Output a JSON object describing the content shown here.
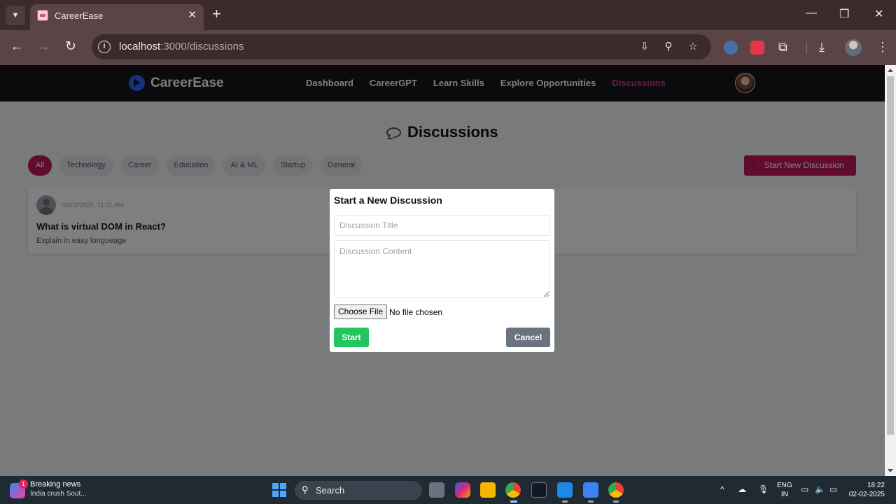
{
  "browser": {
    "tab_title": "CareerEase",
    "url_host": "localhost",
    "url_path": ":3000/discussions"
  },
  "nav": {
    "brand": "CareerEase",
    "links": [
      "Dashboard",
      "CareerGPT",
      "Learn Skills",
      "Explore Opportunities",
      "Discussions"
    ],
    "active_link": "Discussions"
  },
  "page": {
    "title": "Discussions",
    "filters": [
      "All",
      "Technology",
      "Career",
      "Education",
      "AI & ML",
      "Startup",
      "General"
    ],
    "active_filter": "All",
    "start_button": "Start New Discussion"
  },
  "posts": [
    {
      "date": "02/02/2025, 11:31 AM",
      "title": "What is virtual DOM in React?",
      "content": "Explain in easy longueage"
    }
  ],
  "modal": {
    "heading": "Start a New Discussion",
    "title_placeholder": "Discussion Title",
    "content_placeholder": "Discussion Content",
    "file_button": "Choose File",
    "file_status": "No file chosen",
    "start_label": "Start",
    "cancel_label": "Cancel"
  },
  "taskbar": {
    "news_title": "Breaking news",
    "news_sub": "India crush Sout...",
    "news_badge": "1",
    "search_label": "Search",
    "lang_line1": "ENG",
    "lang_line2": "IN",
    "time": "18:22",
    "date": "02-02-2025"
  },
  "colors": {
    "accent": "#c2185b",
    "nav_bg": "#16151a",
    "start_green": "#22c55e",
    "cancel_gray": "#6b7280"
  }
}
